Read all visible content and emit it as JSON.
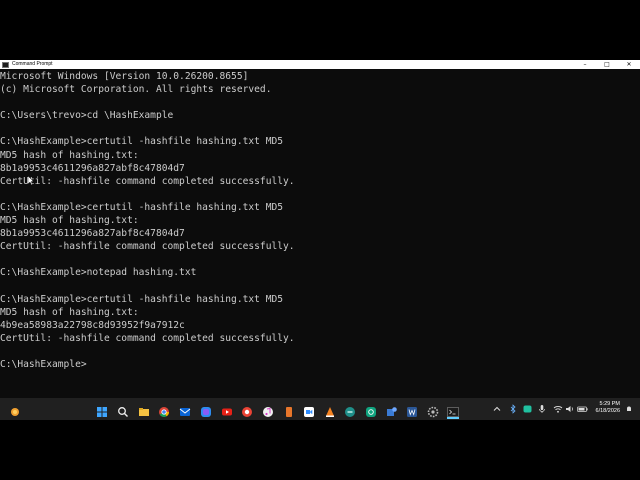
{
  "window": {
    "title": "Command Prompt",
    "controls": {
      "minimize": "–",
      "maximize": "□",
      "close": "✕"
    }
  },
  "console": {
    "lines": [
      "Microsoft Windows [Version 10.0.26200.8655]",
      "(c) Microsoft Corporation. All rights reserved.",
      "",
      "C:\\Users\\trevo>cd \\HashExample",
      "",
      "C:\\HashExample>certutil -hashfile hashing.txt MD5",
      "MD5 hash of hashing.txt:",
      "8b1a9953c4611296a827abf8c47804d7",
      "CertUtil: -hashfile command completed successfully.",
      "",
      "C:\\HashExample>certutil -hashfile hashing.txt MD5",
      "MD5 hash of hashing.txt:",
      "8b1a9953c4611296a827abf8c47804d7",
      "CertUtil: -hashfile command completed successfully.",
      "",
      "C:\\HashExample>notepad hashing.txt",
      "",
      "C:\\HashExample>certutil -hashfile hashing.txt MD5",
      "MD5 hash of hashing.txt:",
      "4b9ea58983a22798c8d93952f9a7912c",
      "CertUtil: -hashfile command completed successfully.",
      "",
      "C:\\HashExample>"
    ]
  },
  "taskbar": {
    "pinned": [
      "start-icon",
      "search-icon",
      "file-explorer-icon",
      "chrome-icon",
      "outlook-icon",
      "copilot-icon",
      "youtube-icon",
      "chrome-alt-icon",
      "itunes-icon",
      "notes-icon",
      "zoom-icon",
      "vlc-icon",
      "app-teal-icon",
      "chatgpt-icon",
      "puzzle-icon",
      "word-icon",
      "settings-icon",
      "terminal-icon"
    ],
    "clock": {
      "time": "5:29 PM",
      "date": "6/18/2026"
    }
  },
  "colors": {
    "console_bg": "#0c0c0c",
    "console_fg": "#cccccc",
    "taskbar_bg": "#202020",
    "titlebar_bg": "#ffffff"
  }
}
